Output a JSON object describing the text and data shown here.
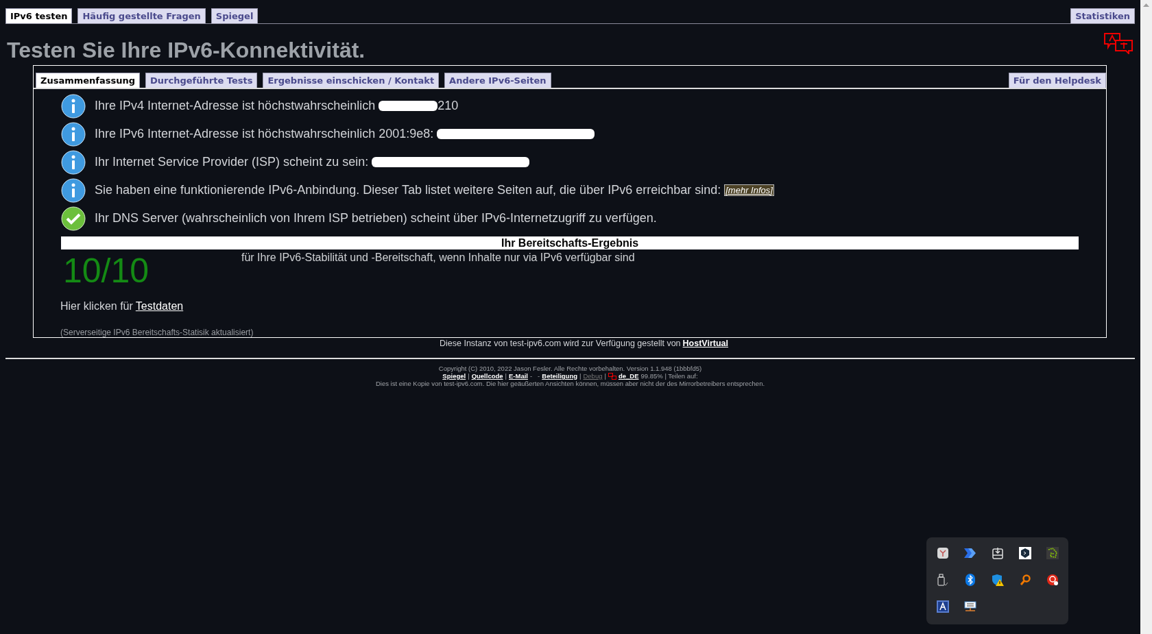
{
  "top_tabs": [
    {
      "label": "IPv6 testen",
      "selected": true
    },
    {
      "label": "Häufig gestellte Fragen",
      "selected": false
    },
    {
      "label": "Spiegel",
      "selected": false
    }
  ],
  "top_right_tab": {
    "label": "Statistiken",
    "selected": false
  },
  "title": "Testen Sie Ihre IPv6-Konnektivität.",
  "panel_tabs": [
    {
      "label": "Zusammenfassung",
      "selected": true
    },
    {
      "label": "Durchgeführte Tests",
      "selected": false
    },
    {
      "label": "Ergebnisse einschicken / Kontakt",
      "selected": false
    },
    {
      "label": "Andere IPv6-Seiten",
      "selected": false
    }
  ],
  "panel_right_tab": {
    "label": "Für den Helpdesk",
    "selected": false
  },
  "results": [
    {
      "kind": "info",
      "text": "Ihre IPv4 Internet-Adresse ist höchstwahrscheinlich",
      "redacted": true,
      "suffix": "210"
    },
    {
      "kind": "info",
      "text": "Ihre IPv6 Internet-Adresse ist höchstwahrscheinlich 2001:9e8:",
      "redacted": true
    },
    {
      "kind": "info",
      "text": "Ihr Internet Service Provider (ISP) scheint zu sein:",
      "redacted": true
    },
    {
      "kind": "info",
      "text": "Sie haben eine funktionierende IPv6-Anbindung. Dieser Tab listet weitere Seiten auf, die über IPv6 erreichbar sind:",
      "redacted": false,
      "link": "[mehr Infos]"
    },
    {
      "kind": "ok",
      "text": "Ihr DNS Server (wahrscheinlich von Ihrem ISP betrieben) scheint über IPv6-Internetzugriff zu verfügen.",
      "redacted": false
    }
  ],
  "score": {
    "heading": "Ihr Bereitschafts-Ergebnis",
    "value": "10/10",
    "description": "für Ihre IPv6-Stabilität und -Bereitschaft, wenn Inhalte nur via IPv6 verfügbar sind"
  },
  "test_data": {
    "text": "Hier klicken für",
    "link": "Testdaten"
  },
  "server_note": "(Serverseitige IPv6 Bereitschafts-Statisik aktualisiert)",
  "sponsor": {
    "text": "Diese Instanz von test-ipv6.com wird zur Verfügung gestellt von",
    "link": "HostVirtual"
  },
  "footer": {
    "copyright": "Copyright (C) 2010, 2022 Jason Fesler. Alle Rechte vorbehalten. Version 1.1.948 (1bbbfd5)",
    "links": [
      {
        "kind": "link",
        "text": "Spiegel"
      },
      {
        "kind": "text",
        "text": "|"
      },
      {
        "kind": "link",
        "text": "Quellcode"
      },
      {
        "kind": "text",
        "text": "|"
      },
      {
        "kind": "link",
        "text": "E-Mail"
      },
      {
        "kind": "text",
        "text": "-   -"
      },
      {
        "kind": "link",
        "text": "Beteiligung"
      },
      {
        "kind": "text",
        "text": "|"
      },
      {
        "kind": "muted_link",
        "text": "Debug"
      },
      {
        "kind": "text",
        "text": "|"
      },
      {
        "kind": "flag_link",
        "text": "de_DE"
      },
      {
        "kind": "text",
        "text": "99.85% | Teilen auf:"
      }
    ],
    "disclaimer": "Dies ist eine Kopie von test-ipv6.com. Die hier geäußerten Ansichten können, müssen aber nicht der des Mirrorbetreibers entsprechen."
  }
}
